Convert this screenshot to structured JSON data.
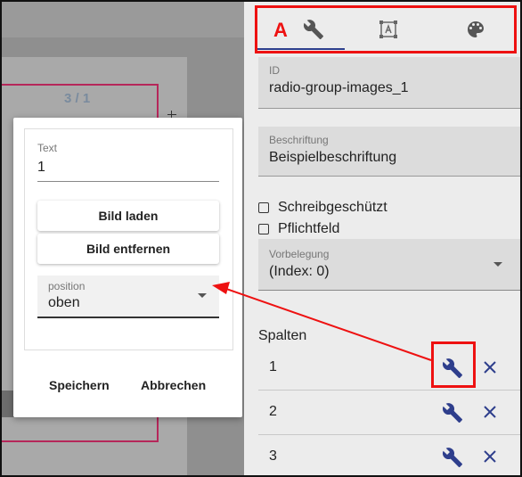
{
  "canvas": {
    "page_counter": "3 / 1"
  },
  "dialog": {
    "text_field": {
      "label": "Text",
      "value": "1"
    },
    "load_image_label": "Bild laden",
    "remove_image_label": "Bild entfernen",
    "position_select": {
      "label": "position",
      "value": "oben"
    },
    "save_label": "Speichern",
    "cancel_label": "Abbrechen"
  },
  "panel": {
    "tabs": {
      "active_marker": "A",
      "items": [
        {
          "icon": "wrench-icon"
        },
        {
          "icon": "text-frame-icon"
        },
        {
          "icon": "palette-icon"
        }
      ]
    },
    "id_field": {
      "label": "ID",
      "value": "radio-group-images_1"
    },
    "caption_field": {
      "label": "Beschriftung",
      "value": "Beispielbeschriftung"
    },
    "readonly_label": "Schreibgeschützt",
    "required_label": "Pflichtfeld",
    "default_select": {
      "label": "Vorbelegung",
      "value": "(Index: 0)"
    },
    "columns_title": "Spalten",
    "columns": [
      {
        "num": "1"
      },
      {
        "num": "2"
      },
      {
        "num": "3"
      }
    ]
  },
  "colors": {
    "accent": "#2e3e8c",
    "highlight": "#e11111"
  }
}
